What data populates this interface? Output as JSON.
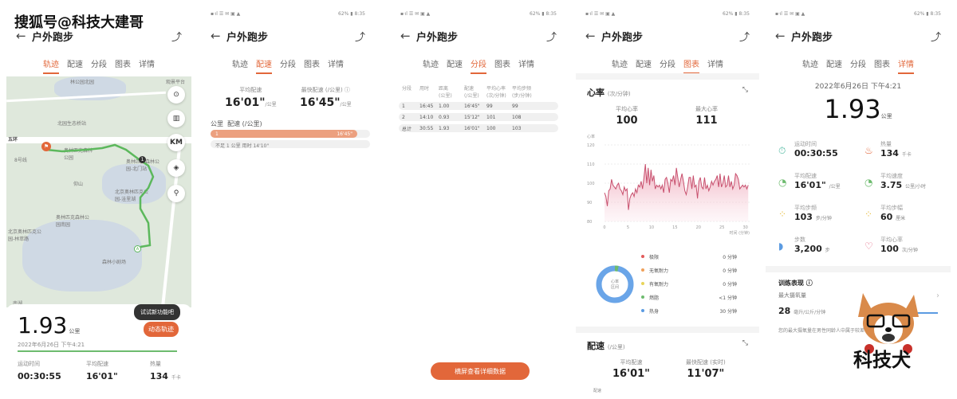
{
  "watermark": "搜狐号@科技大建哥",
  "sticker_text": "科技犬",
  "status_bar": {
    "left": "▪ᐧıl ☰ ✉ ▣ ▲",
    "battery": "62%",
    "time": "8:35"
  },
  "header": {
    "title": "户外跑步"
  },
  "tabs": [
    "轨迹",
    "配速",
    "分段",
    "图表",
    "详情"
  ],
  "colors": {
    "accent": "#e2673a",
    "route": "#5cb85c",
    "hr_line": "#c8506e"
  },
  "track": {
    "map_labels": [
      "林公园北园",
      "观景平台",
      "北园生态桥站",
      "五环",
      "8号线",
      "奥林匹克森林公园",
      "奥林匹克森林公园-北门站",
      "仰山",
      "北京奥林匹克公园-洼里湖",
      "奥林匹克森林公园南园",
      "北京奥林匹克公园-林萃路",
      "森林小剧场",
      "南湖"
    ],
    "map_buttons": [
      "locate",
      "map",
      "KM",
      "layers",
      "person-pin"
    ],
    "km_label": "KM",
    "distance": "1.93",
    "distance_unit": "公里",
    "date": "2022年6月26日 下午4:21",
    "tooltip": "试试新功能吧",
    "dynamic_btn": "动态轨迹",
    "stats": [
      {
        "label": "运动时间",
        "value": "00:30:55",
        "unit": ""
      },
      {
        "label": "平均配速",
        "value": "16'01\"",
        "unit": ""
      },
      {
        "label": "热量",
        "value": "134",
        "unit": "千卡"
      }
    ]
  },
  "pace": {
    "avg_label": "平均配速",
    "avg_value": "16'01\"",
    "avg_unit": "/公里",
    "fast_label": "最快配速 (/公里) ⓘ",
    "fast_value": "16'45\"",
    "fast_unit": "/公里",
    "col_km": "公里",
    "col_pace": "配速 (/公里)",
    "bars": [
      {
        "km": "1",
        "pace": "16'45\"",
        "fraction": 0.92
      }
    ],
    "note": "不足 1 公里 用时 14'10\""
  },
  "segments": {
    "headers": [
      "分段",
      "用时",
      "距离\n(公里)",
      "配速\n(/公里)",
      "平均心率\n(次/分钟)",
      "平均步频\n(步/分钟)"
    ],
    "rows": [
      [
        "1",
        "16:45",
        "1.00",
        "16'45\"",
        "99",
        "99"
      ],
      [
        "2",
        "14:10",
        "0.93",
        "15'12\"",
        "101",
        "108"
      ],
      [
        "总计",
        "30:55",
        "1.93",
        "16'01\"",
        "100",
        "103"
      ]
    ],
    "landscape_btn": "横屏查看详细数据"
  },
  "chart_page": {
    "hr_title": "心率",
    "hr_unit": "(次/分钟)",
    "avg_hr_label": "平均心率",
    "avg_hr": "100",
    "max_hr_label": "最大心率",
    "max_hr": "111",
    "donut_label": "心率\n区间",
    "zones": [
      {
        "name": "极限",
        "value": "0 分钟",
        "color": "#e25b5b"
      },
      {
        "name": "无氧耐力",
        "value": "0 分钟",
        "color": "#f0a05a"
      },
      {
        "name": "有氧耐力",
        "value": "0 分钟",
        "color": "#e8d45a"
      },
      {
        "name": "燃脂",
        "value": "<1 分钟",
        "color": "#6dbb6e"
      },
      {
        "name": "热身",
        "value": "30 分钟",
        "color": "#5b9be2"
      }
    ],
    "pace_title": "配速",
    "pace_unit": "(/公里)",
    "avg_pace_label": "平均配速",
    "avg_pace": "16'01\"",
    "fast_pace_label": "最快配速 (实时)",
    "fast_pace": "11'07\"",
    "pace_axis_label": "配速"
  },
  "chart_data": {
    "type": "area",
    "title": "心率",
    "ylabel": "心率",
    "xlabel": "时间 (分钟)",
    "ylim": [
      80,
      120
    ],
    "xlim": [
      0,
      30.9
    ],
    "yticks": [
      80,
      90,
      100,
      110,
      120
    ],
    "xticks": [
      0,
      5,
      10,
      15,
      20,
      25,
      30
    ],
    "x": [
      0,
      0.3,
      0.6,
      0.9,
      1.2,
      1.5,
      1.8,
      2.1,
      2.4,
      2.7,
      3.0,
      3.3,
      3.6,
      3.9,
      4.2,
      4.5,
      4.8,
      5.1,
      5.4,
      5.7,
      6.0,
      6.3,
      6.6,
      6.9,
      7.2,
      7.5,
      7.8,
      8.1,
      8.4,
      8.7,
      9.0,
      9.3,
      9.6,
      9.9,
      10.2,
      10.5,
      10.8,
      11.1,
      11.4,
      11.7,
      12.0,
      12.3,
      12.6,
      12.9,
      13.2,
      13.5,
      13.8,
      14.1,
      14.4,
      14.7,
      15.0,
      15.3,
      15.6,
      15.9,
      16.2,
      16.5,
      16.8,
      17.1,
      17.4,
      17.7,
      18.0,
      18.3,
      18.6,
      18.9,
      19.2,
      19.5,
      19.8,
      20.1,
      20.4,
      20.7,
      21.0,
      21.3,
      21.6,
      21.9,
      22.2,
      22.5,
      22.8,
      23.1,
      23.4,
      23.7,
      24.0,
      24.3,
      24.6,
      24.9,
      25.2,
      25.5,
      25.8,
      26.1,
      26.4,
      26.7,
      27.0,
      27.3,
      27.6,
      27.9,
      28.2,
      28.5,
      28.8,
      29.1,
      29.4,
      29.7,
      30.0,
      30.3,
      30.6
    ],
    "values": [
      95,
      93,
      88,
      96,
      97,
      102,
      99,
      98,
      97,
      99,
      100,
      97,
      96,
      94,
      98,
      96,
      97,
      86,
      92,
      94,
      95,
      93,
      97,
      95,
      99,
      98,
      101,
      97,
      103,
      110,
      100,
      108,
      99,
      107,
      101,
      104,
      97,
      99,
      98,
      99,
      97,
      99,
      95,
      102,
      103,
      100,
      95,
      102,
      101,
      104,
      99,
      108,
      103,
      98,
      102,
      105,
      101,
      96,
      94,
      98,
      103,
      103,
      97,
      104,
      98,
      99,
      92,
      101,
      103,
      98,
      97,
      103,
      97,
      99,
      96,
      98,
      101,
      99,
      101,
      102,
      104,
      98,
      105,
      98,
      100,
      104,
      98,
      99,
      104,
      98,
      101,
      97,
      99,
      105,
      104,
      102,
      97,
      98,
      99,
      98,
      99,
      97,
      99
    ]
  },
  "details": {
    "date": "2022年6月26日 下午4:21",
    "distance": "1.93",
    "distance_unit": "公里",
    "items": [
      {
        "label": "运动时间",
        "value": "00:30:55",
        "unit": "",
        "icon": "stopwatch-icon",
        "glyph": "⏱",
        "color": "#4db8a0"
      },
      {
        "label": "热量",
        "value": "134",
        "unit": "千卡",
        "icon": "flame-icon",
        "glyph": "♨",
        "color": "#e2673a"
      },
      {
        "label": "平均配速",
        "value": "16'01\"",
        "unit": "/公里",
        "icon": "pace-gauge-icon",
        "glyph": "◔",
        "color": "#6dbb6e"
      },
      {
        "label": "平均速度",
        "value": "3.75",
        "unit": "公里/小时",
        "icon": "speed-gauge-icon",
        "glyph": "◔",
        "color": "#6dbb6e"
      },
      {
        "label": "平均步频",
        "value": "103",
        "unit": "步/分钟",
        "icon": "footsteps-icon",
        "glyph": "⁘",
        "color": "#e8c14a"
      },
      {
        "label": "平均步幅",
        "value": "60",
        "unit": "厘米",
        "icon": "stride-icon",
        "glyph": "⁘",
        "color": "#e8c14a"
      },
      {
        "label": "步数",
        "value": "3,200",
        "unit": "步",
        "icon": "shoe-icon",
        "glyph": "◗",
        "color": "#5b9be2"
      },
      {
        "label": "平均心率",
        "value": "100",
        "unit": "次/分钟",
        "icon": "heart-icon",
        "glyph": "♡",
        "color": "#e25b7a"
      }
    ],
    "training_title": "训练表现 ⓘ",
    "vo2_label": "最大摄氧量",
    "vo2_value": "28",
    "vo2_unit": "毫升/公斤/分钟",
    "vo2_note": "您的最大摄氧量在男性同龄人中属于较差"
  }
}
